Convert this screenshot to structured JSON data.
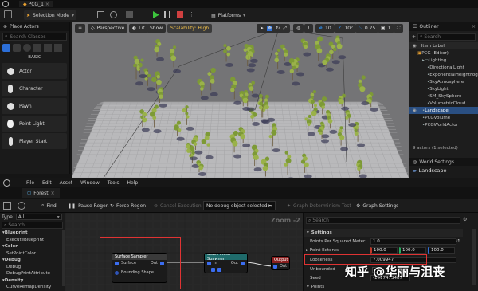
{
  "editor": {
    "tab_title": "PCG_1",
    "selection_mode": "Selection Mode",
    "platforms": "Platforms"
  },
  "place_actors": {
    "title": "Place Actors",
    "search_placeholder": "Search Classes",
    "category": "BASIC",
    "items": [
      {
        "label": "Actor",
        "icon": "actor-icon"
      },
      {
        "label": "Character",
        "icon": "character-icon"
      },
      {
        "label": "Pawn",
        "icon": "pawn-icon"
      },
      {
        "label": "Point Light",
        "icon": "point-light-icon"
      },
      {
        "label": "Player Start",
        "icon": "player-start-icon"
      }
    ]
  },
  "viewport": {
    "perspective": "Perspective",
    "lit": "Lit",
    "show": "Show",
    "scalability": "Scalability: High",
    "grid_snap": "10",
    "rotation_snap": "10°",
    "scale_snap": "0.25",
    "camera_speed": "1"
  },
  "outliner": {
    "title": "Outliner",
    "search_placeholder": "Search",
    "column": "Item Label",
    "rows": [
      {
        "label": "PCG (Editor)",
        "indent": 1,
        "selected": false
      },
      {
        "label": "Lighting",
        "indent": 2,
        "selected": false
      },
      {
        "label": "DirectionalLight",
        "indent": 3,
        "selected": false
      },
      {
        "label": "ExponentialHeightFog",
        "indent": 3,
        "selected": false
      },
      {
        "label": "SkyAtmosphere",
        "indent": 3,
        "selected": false
      },
      {
        "label": "SkyLight",
        "indent": 3,
        "selected": false
      },
      {
        "label": "SM_SkySphere",
        "indent": 3,
        "selected": false
      },
      {
        "label": "VolumetricCloud",
        "indent": 3,
        "selected": false
      },
      {
        "label": "Landscape",
        "indent": 2,
        "selected": true
      },
      {
        "label": "PCGVolume",
        "indent": 2,
        "selected": false
      },
      {
        "label": "PCGWorldActor",
        "indent": 2,
        "selected": false
      }
    ],
    "status": "9 actors (1 selected)"
  },
  "world_settings": {
    "tab": "World Settings",
    "header": "Landscape"
  },
  "pcg_editor": {
    "menu": [
      "File",
      "Edit",
      "Asset",
      "Window",
      "Tools",
      "Help"
    ],
    "tab": "Forest",
    "toolbar": {
      "find": "Find",
      "pause_regen": "Pause Regen",
      "force_regen": "Force Regen",
      "cancel_execution": "Cancel Execution",
      "debug_object": "No debug object selected",
      "graph_determinism": "Graph Determinism Test",
      "graph_settings": "Graph Settings"
    },
    "palette": {
      "type_label": "Type",
      "type_value": "All",
      "search_placeholder": "Search",
      "rows": [
        {
          "label": "Blueprint",
          "category": true
        },
        {
          "label": "ExecuteBlueprint",
          "category": false
        },
        {
          "label": "Color",
          "category": true
        },
        {
          "label": "SetPointColor",
          "category": false
        },
        {
          "label": "Debug",
          "category": true
        },
        {
          "label": "Debug",
          "category": false
        },
        {
          "label": "DebugPrintAttribute",
          "category": false
        },
        {
          "label": "Density",
          "category": true
        },
        {
          "label": "CurveRemapDensity",
          "category": false
        }
      ]
    },
    "graph": {
      "zoom": "Zoom -2",
      "nodes": {
        "surface_sampler": {
          "title": "Surface Sampler",
          "pin_surface": "Surface",
          "pin_out": "Out",
          "pin_bounding": "Bounding Shape"
        },
        "static_mesh_spawner": {
          "title": "Static Mesh Spawner",
          "pin_in": "In",
          "pin_out": "Out"
        },
        "output": {
          "title": "Output",
          "pin_out": "Out"
        }
      }
    },
    "details": {
      "search_placeholder": "Search",
      "section": "Settings",
      "points_per_sqm_label": "Points Per Squared Meter",
      "points_per_sqm": "1.0",
      "point_extents_label": "Point Extents",
      "point_extents": [
        "100.0",
        "100.0",
        "100.0"
      ],
      "looseness_label": "Looseness",
      "looseness": "7.009947",
      "unbounded_label": "Unbounded",
      "seed_label": "Seed",
      "seed": "-1017473487",
      "points_section": "Points"
    }
  },
  "watermark": "知乎 @华丽与沮丧",
  "colors": {
    "highlight_red": "#e03333",
    "pin_blue": "#3b6df0",
    "selection_blue": "#2a4f82",
    "spawner_header": "#1f6b6b",
    "output_header": "#8b1f1f"
  }
}
